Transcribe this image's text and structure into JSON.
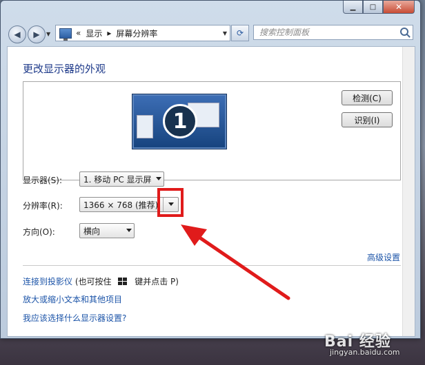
{
  "titlebar": {
    "min": "▁",
    "max": "□",
    "close": "✕"
  },
  "nav": {
    "back_glyph": "◀",
    "forward_glyph": "▶",
    "breadcrumb": {
      "prefix": "«",
      "item1": "显示",
      "sep": "▸",
      "item2": "屏幕分辨率"
    },
    "refresh_glyph": "⟳",
    "search_placeholder": "搜索控制面板"
  },
  "content": {
    "heading": "更改显示器的外观",
    "monitor_number": "1",
    "detect_button": "检测(C)",
    "identify_button": "识别(I)",
    "display_label": "显示器(S):",
    "display_value": "1. 移动 PC 显示屏",
    "resolution_label": "分辨率(R):",
    "resolution_value": "1366 × 768 (推荐)",
    "orientation_label": "方向(O):",
    "orientation_value": "横向",
    "advanced_link": "高级设置",
    "projector_link": "连接到投影仪",
    "projector_hint_a": "(也可按住",
    "projector_hint_b": "键并点击 P)",
    "text_size_link": "放大或缩小文本和其他项目",
    "which_settings_link": "我应该选择什么显示器设置?"
  },
  "annotation": {
    "color": "#e01b1b"
  },
  "watermark": {
    "brand": "Bai 经验",
    "url": "jingyan.baidu.com"
  }
}
